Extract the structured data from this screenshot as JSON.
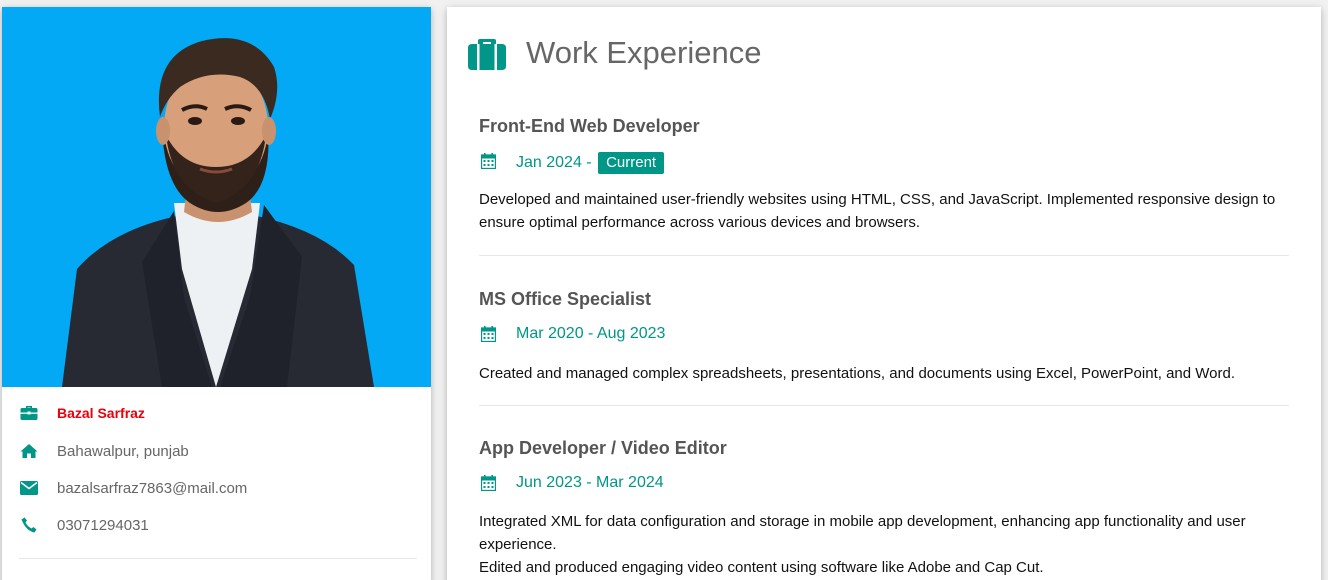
{
  "profile": {
    "name": "Bazal Sarfraz",
    "location": "Bahawalpur, punjab",
    "email": "bazalsarfraz7863@mail.com",
    "phone": "03071294031",
    "icons": [
      "briefcase-icon",
      "home-icon",
      "envelope-icon",
      "phone-icon"
    ],
    "accent_color": "#009688",
    "name_color": "#e8000b",
    "photo_bg": "#03a9f4"
  },
  "experience": {
    "title": "Work Experience",
    "icon": "briefcase-icon",
    "jobs": [
      {
        "title": "Front-End Web Developer",
        "date": "Jan 2024 -",
        "badge": "Current",
        "description": [
          "Developed and maintained user-friendly websites using HTML, CSS, and JavaScript. Implemented responsive design to ensure optimal performance across various devices and browsers."
        ]
      },
      {
        "title": "MS Office Specialist",
        "date": "Mar 2020 - Aug 2023",
        "description": [
          "Created and managed complex spreadsheets, presentations, and documents using Excel, PowerPoint, and Word."
        ]
      },
      {
        "title": "App Developer / Video Editor",
        "date": "Jun 2023 - Mar 2024",
        "description": [
          "Integrated XML for data configuration and storage in mobile app development, enhancing app functionality and user experience.",
          "Edited and produced engaging video content using software like Adobe and Cap Cut."
        ]
      }
    ]
  }
}
